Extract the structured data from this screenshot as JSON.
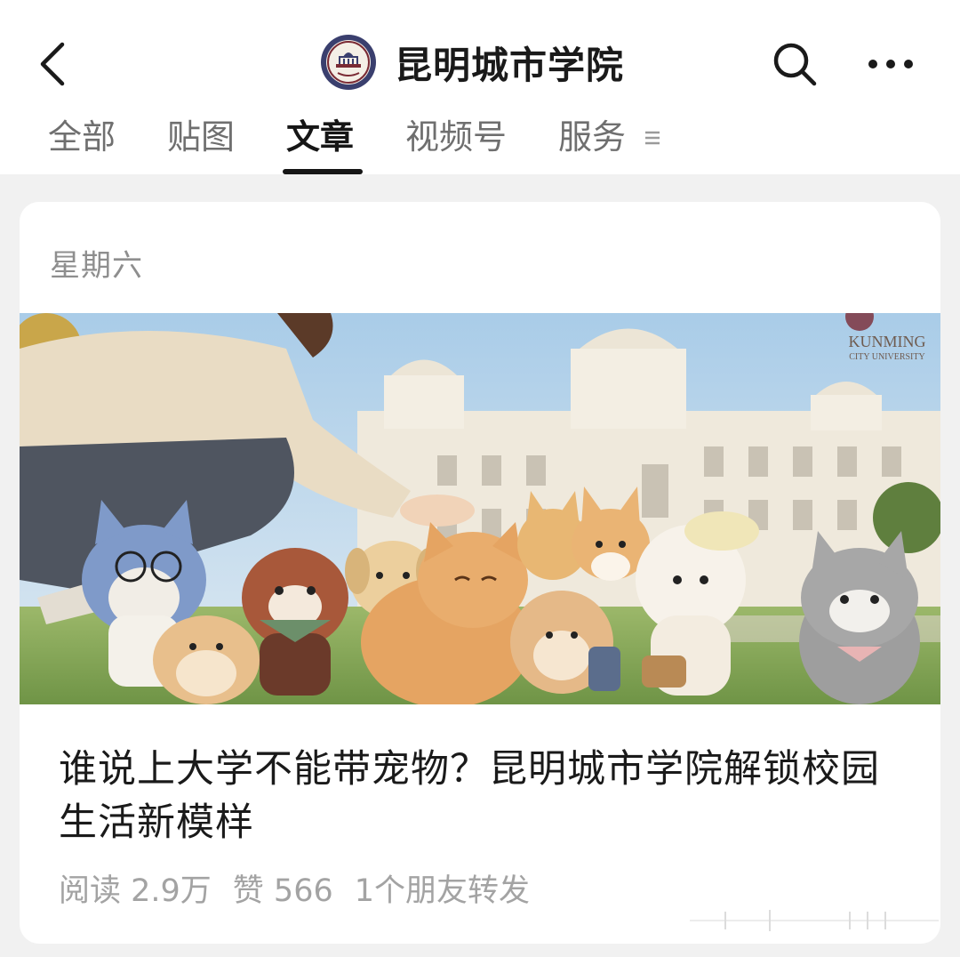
{
  "header": {
    "title": "昆明城市学院"
  },
  "tabs": [
    {
      "label": "全部"
    },
    {
      "label": "贴图"
    },
    {
      "label": "文章"
    },
    {
      "label": "视频号"
    },
    {
      "label": "服务"
    }
  ],
  "active_tab": "文章",
  "article": {
    "date": "星期六",
    "title": "谁说上大学不能带宠物？昆明城市学院解锁校园生活新模样",
    "reads": "阅读 2.9万",
    "likes": "赞 566",
    "shares": "1个朋友转发",
    "cover_logo_text_1": "KUNMING",
    "cover_logo_text_2": "CITY UNIVERSITY"
  },
  "colors": {
    "background": "#f1f1f1",
    "card": "#ffffff",
    "text_primary": "#1a1a1a",
    "text_secondary": "#8e8e8e",
    "text_meta": "#a3a3a3"
  },
  "icons": [
    "back-arrow-icon",
    "university-logo",
    "search-icon",
    "more-icon",
    "menu-icon"
  ]
}
